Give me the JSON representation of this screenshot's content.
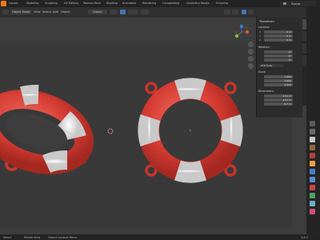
{
  "workspace_tabs": [
    "Layout",
    "Modeling",
    "Sculpting",
    "UV Editing",
    "Texture Paint",
    "Shading",
    "Animation",
    "Rendering",
    "Compositing",
    "Geometry Nodes",
    "Scripting"
  ],
  "scene": {
    "label": "Scene"
  },
  "viewport_header": {
    "mode": "Object Mode",
    "menus": [
      "View",
      "Select",
      "Add",
      "Object"
    ],
    "transform": "Global"
  },
  "npanel": {
    "title": "Transform",
    "location": {
      "label": "Location",
      "x": "0 m",
      "y": "0 m",
      "z": "0 m"
    },
    "rotation": {
      "label": "Rotation",
      "x": "0°",
      "y": "0°",
      "z": "0°"
    },
    "rotation_mode": "XYZ Euler",
    "scale": {
      "label": "Scale",
      "x": "1.000",
      "y": "1.000",
      "z": "1.000"
    },
    "dimensions": {
      "label": "Dimensions",
      "x": "2.51 m",
      "y": "2.51 m",
      "z": "0.7 m"
    }
  },
  "side_tabs": [
    "Item",
    "Tool",
    "View"
  ],
  "status": {
    "left": "Select",
    "mid": "Rotate View",
    "right": "Object Context Menu",
    "version": "3.6.0"
  },
  "colors": {
    "ring_red": "#e2483f",
    "ring_white": "#ececec",
    "accent_orange": "#e87d0d",
    "header_blue": "#4772b3"
  }
}
